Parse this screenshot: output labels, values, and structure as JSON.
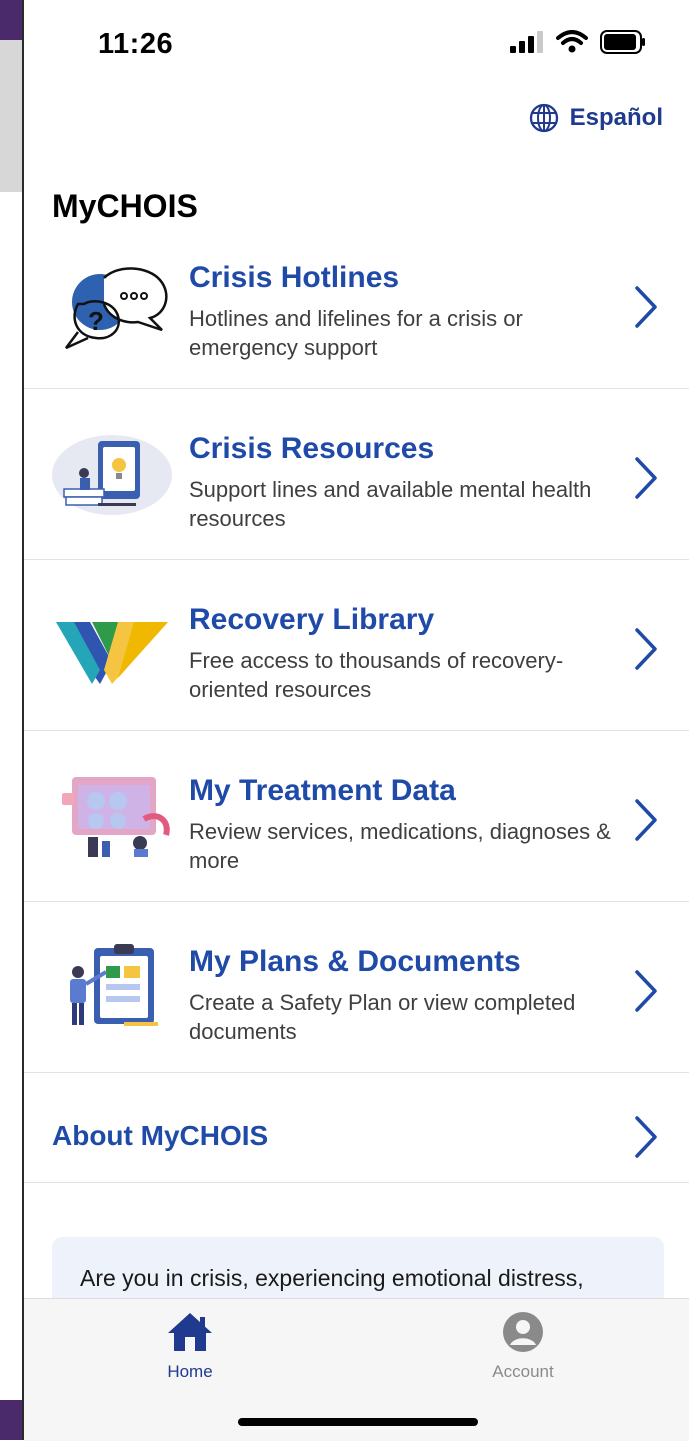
{
  "status_bar": {
    "time": "11:26"
  },
  "language_toggle": {
    "label": "Español",
    "icon": "globe-icon"
  },
  "app": {
    "title": "MyCHOIS"
  },
  "menu": [
    {
      "title": "Crisis Hotlines",
      "desc": "Hotlines and lifelines for a crisis or emergency support",
      "icon": "chat-bubbles-icon"
    },
    {
      "title": "Crisis Resources",
      "desc": "Support lines and available mental health resources",
      "icon": "resources-illustration-icon"
    },
    {
      "title": "Recovery Library",
      "desc": "Free access to thousands of recovery-oriented resources",
      "icon": "triangle-logo-icon"
    },
    {
      "title": "My Treatment Data",
      "desc": "Review services, medications, diagnoses & more",
      "icon": "treatment-data-illustration-icon"
    },
    {
      "title": "My Plans & Documents",
      "desc": "Create a Safety Plan or view completed documents",
      "icon": "clipboard-illustration-icon"
    }
  ],
  "about": {
    "label": "About MyCHOIS"
  },
  "crisis_card": {
    "text": "Are you in crisis, experiencing emotional distress,"
  },
  "tabbar": {
    "home": {
      "label": "Home",
      "icon": "home-icon"
    },
    "account": {
      "label": "Account",
      "icon": "account-icon"
    }
  },
  "colors": {
    "accent": "#1f4aa8",
    "tab_active": "#1f3a8f",
    "tab_inactive": "#8a8a8a",
    "card_bg": "#eef3fb"
  }
}
